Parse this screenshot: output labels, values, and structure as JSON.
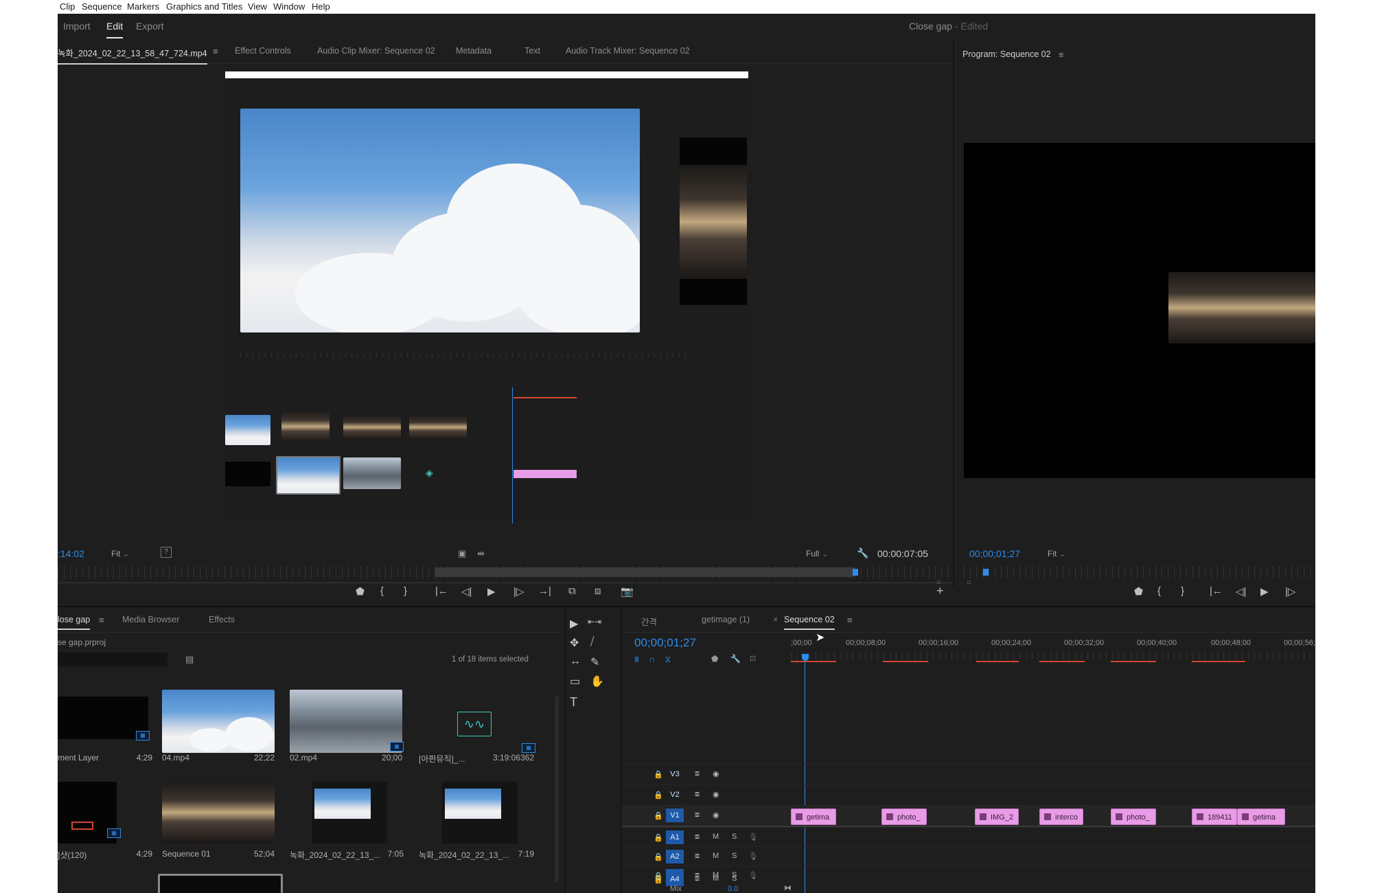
{
  "menubar": {
    "items": [
      "Clip",
      "Sequence",
      "Markers",
      "Graphics and Titles",
      "View",
      "Window",
      "Help"
    ]
  },
  "workspace": {
    "import": "Import",
    "edit": "Edit",
    "export": "Export",
    "doc_title": "Close gap",
    "doc_status": "- Edited"
  },
  "source_panel": {
    "tabs": [
      "녹화_2024_02_22_13_58_47_724.mp4",
      "Effect Controls",
      "Audio Clip Mixer: Sequence 02",
      "Metadata",
      "Text",
      "Audio Track Mixer: Sequence 02"
    ],
    "menu_glyph": "≡",
    "timecode_left": ":14:02",
    "fit": "Fit",
    "quality": "Full",
    "timecode_right": "00:00:07:05",
    "wrench": "🔧",
    "plus": "+",
    "controls": [
      "⬟",
      "{",
      "}",
      "|←",
      "◁|",
      "▶",
      "|▷",
      "→|",
      "⧉",
      "⧈",
      "📷"
    ]
  },
  "program_panel": {
    "title": "Program: Sequence 02",
    "menu_glyph": "≡",
    "timecode": "00;00;01;27",
    "fit": "Fit",
    "controls": [
      "⬟",
      "{",
      "}",
      "|←",
      "◁|",
      "▶",
      "|▷"
    ]
  },
  "project_panel": {
    "tabs": [
      "lose gap",
      "Media Browser",
      "Effects"
    ],
    "menu_glyph": "≡",
    "project_file": "se gap.prproj",
    "count": "1 of 18 items selected",
    "items": [
      {
        "label": "ment Layer",
        "duration": "4;29"
      },
      {
        "label": "04.mp4",
        "duration": "22;22"
      },
      {
        "label": "02.mp4",
        "duration": "20;00"
      },
      {
        "label": "[아판뮤직]_...",
        "duration": "3:19:06362"
      },
      {
        "label": "]샷(120)",
        "duration": "4;29"
      },
      {
        "label": "Sequence 01",
        "duration": "52;04"
      },
      {
        "label": "녹화_2024_02_22_13_...",
        "duration": "7:05"
      },
      {
        "label": "녹화_2024_02_22_13_...",
        "duration": "7:19"
      }
    ]
  },
  "timeline": {
    "tabs": [
      "간격",
      "getimage (1)",
      "Sequence 02"
    ],
    "close_glyph": "×",
    "menu_glyph": "≡",
    "timecode": "00;00;01;27",
    "ruler_labels": [
      ";00;00",
      "00;00;08;00",
      "00;00;16;00",
      "00;00;24;00",
      "00;00;32;00",
      "00;00;40;00",
      "00;00;48;00",
      "00;00;56;"
    ],
    "video_tracks": [
      "V3",
      "V2",
      "V1"
    ],
    "audio_tracks": [
      "A1",
      "A2",
      "A3",
      "A4"
    ],
    "mix_label": "Mix",
    "mix_value": "0.0",
    "m": "M",
    "s": "S",
    "clips": [
      "getima",
      "photo_",
      "IMG_2",
      "interco",
      "photo_",
      "189411",
      "getima"
    ]
  },
  "tools": [
    "▶",
    "⇤⇥",
    "✥",
    "⧸",
    "↔",
    "✎",
    "▭",
    "✋",
    "T"
  ],
  "colors": {
    "accent": "#2d8ceb",
    "clip": "#e89be6",
    "panel": "#1e1e1e",
    "marker": "#d6462e"
  }
}
